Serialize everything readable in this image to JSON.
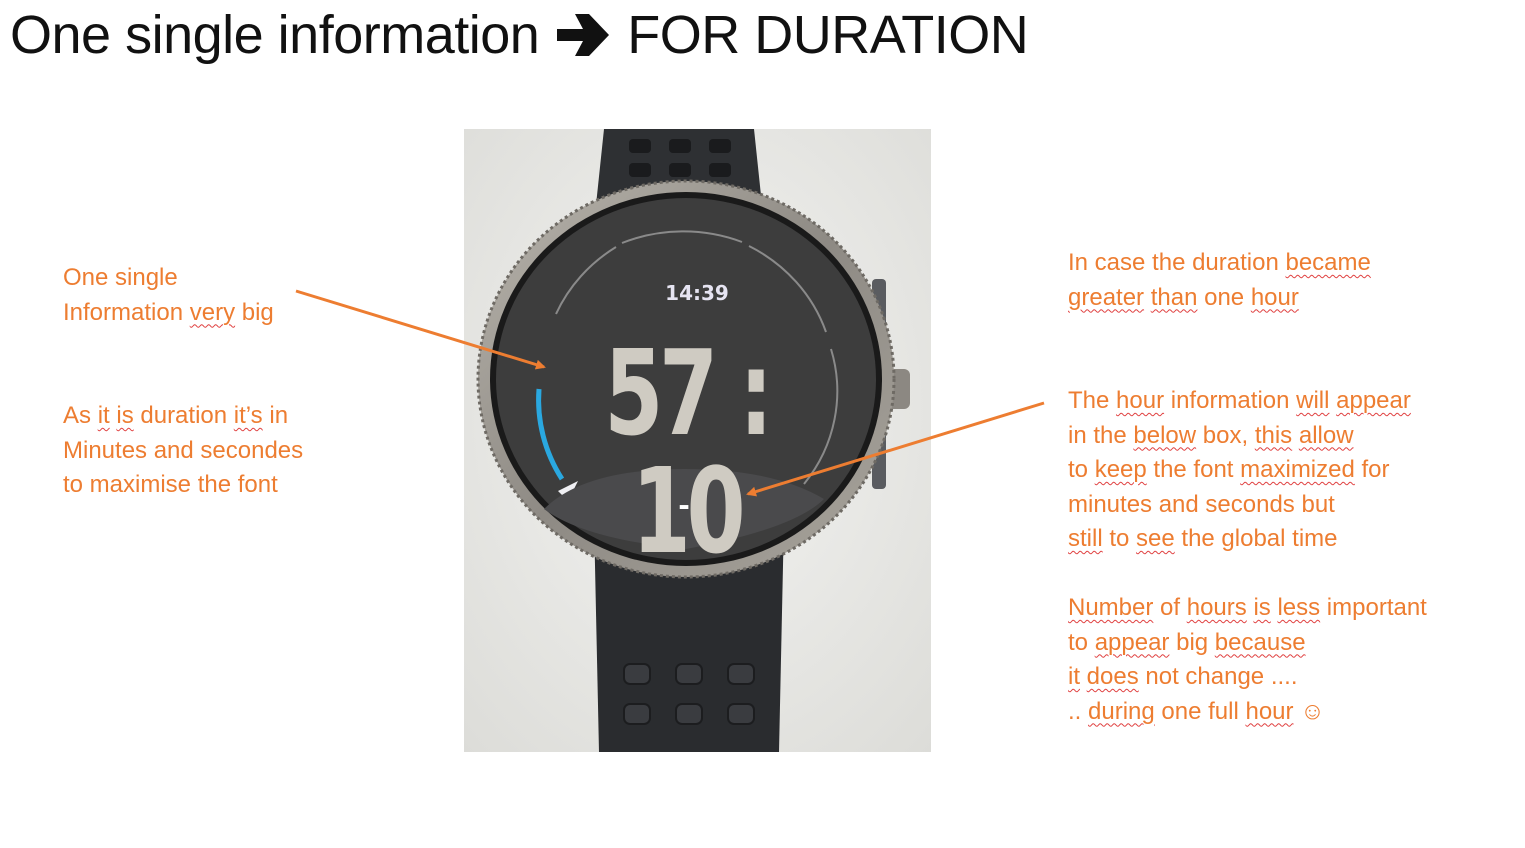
{
  "slide": {
    "title_left": "One single information",
    "title_arrow_icon": "heavy-right-arrow",
    "title_right": "FOR DURATION"
  },
  "left_notes": {
    "block1": [
      "One single",
      "Information very big"
    ],
    "block2": [
      "As it is duration it’s in",
      "Minutes and secondes",
      "to maximise the font"
    ]
  },
  "right_notes": {
    "block1": [
      "In case the duration became",
      "greater than one hour"
    ],
    "block2": [
      "The hour information will appear",
      "in the below box, this allow",
      "to keep the font maximized for",
      "minutes and seconds but",
      "still to see the global time"
    ],
    "block3": [
      "Number of hours is less important",
      "to appear big because",
      "it does not change ....",
      ".. during one full hour ☺"
    ]
  },
  "watch": {
    "clock_time": "14:39",
    "duration": "57 : 10",
    "hour_box_value": "-",
    "progress_arc_color": "#2aa8e0"
  },
  "colors": {
    "annotation": "#ED7D31",
    "title": "#111111"
  }
}
